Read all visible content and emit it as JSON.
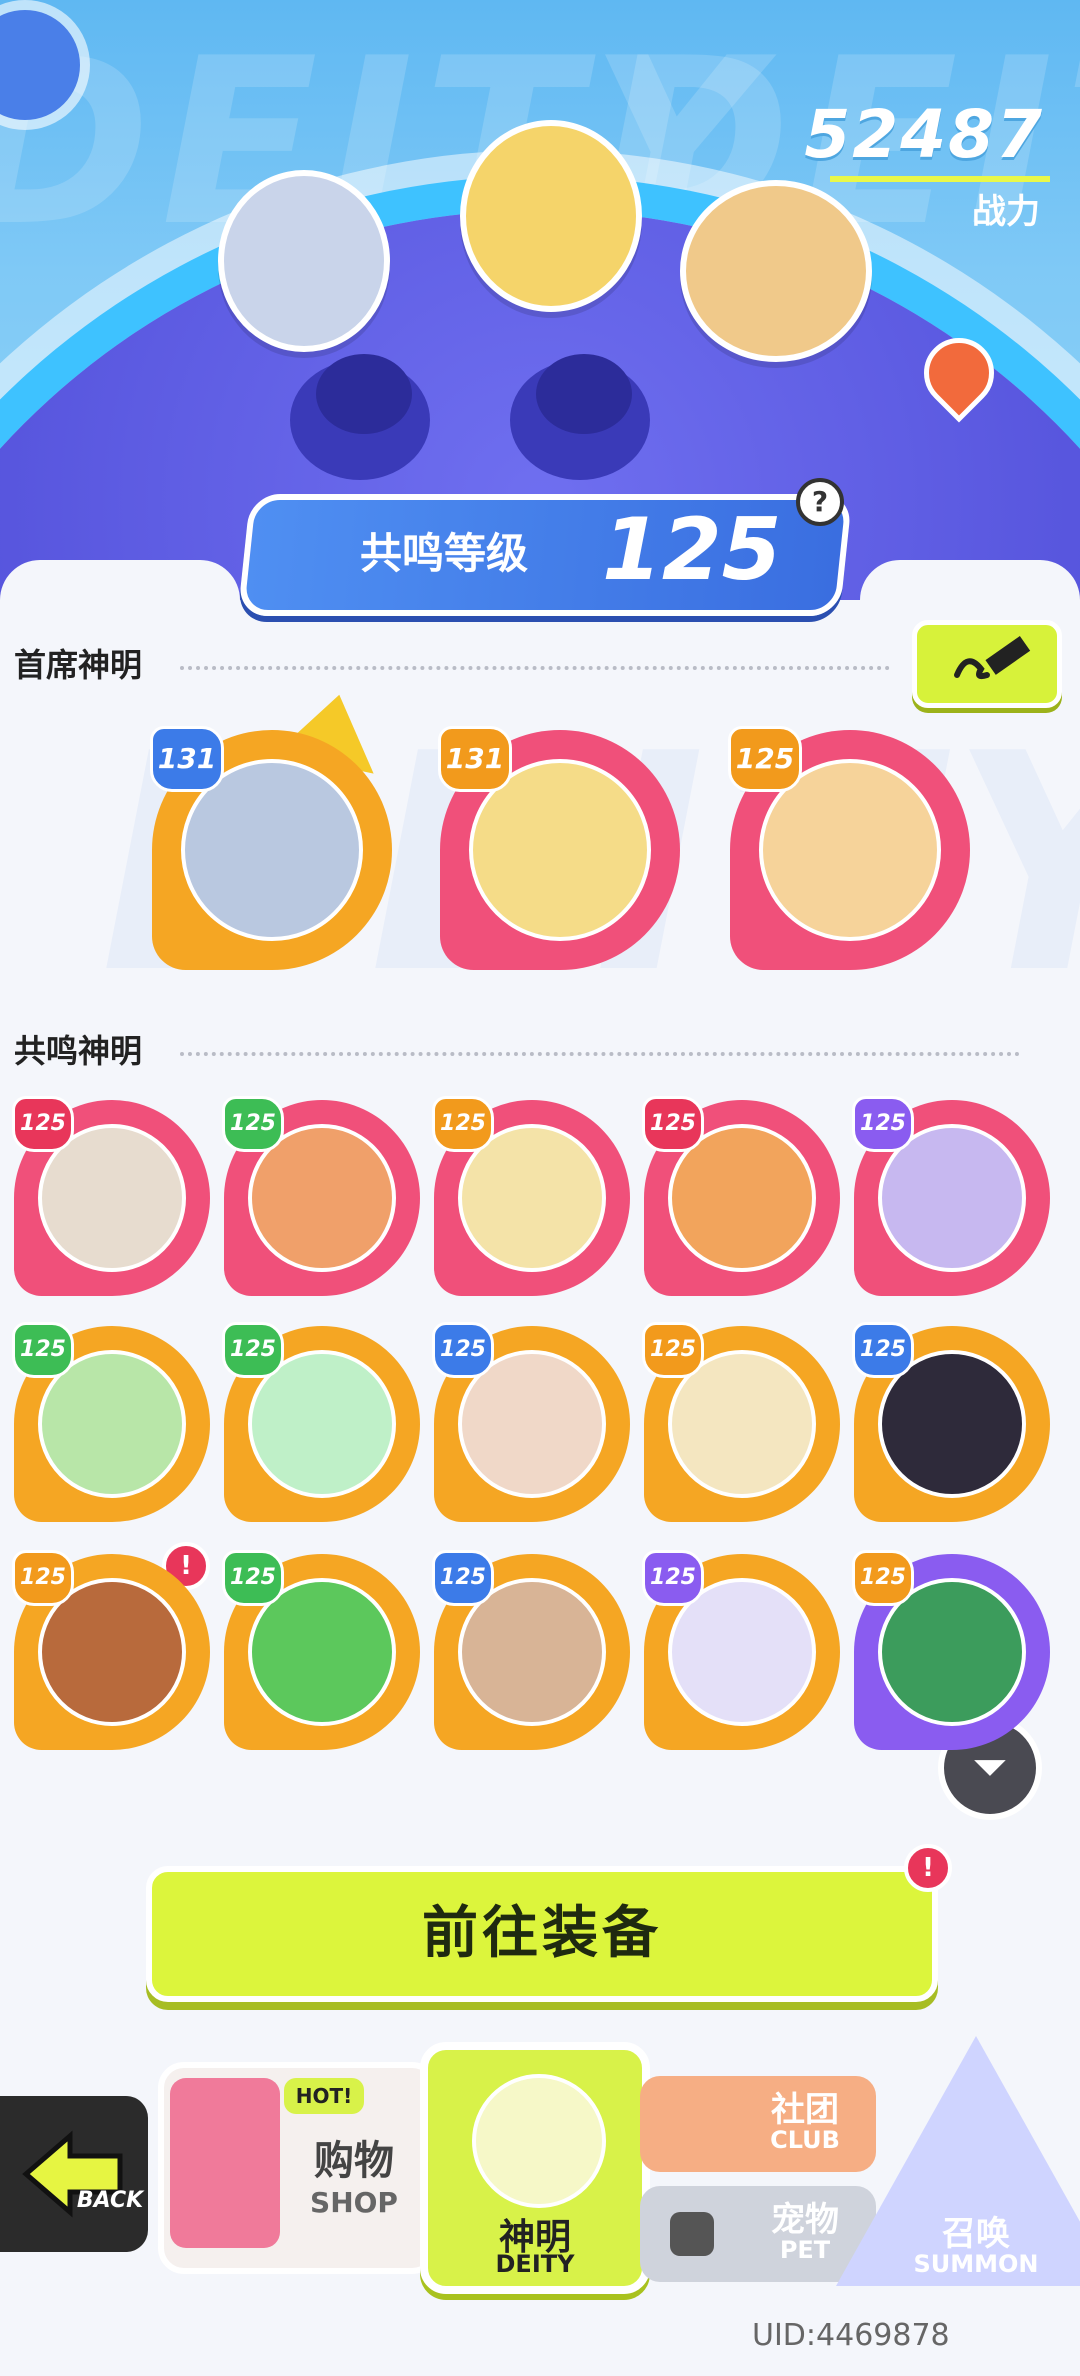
{
  "header": {
    "watermark": "DEITY",
    "power_value": "52487",
    "power_label": "战力",
    "resonance_label": "共鸣等级",
    "resonance_level": "125",
    "help_icon": "?"
  },
  "sections": {
    "primary_title": "首席神明",
    "resonance_title": "共鸣神明"
  },
  "primary_deities": [
    {
      "level": "131",
      "ring": "orange",
      "badge": "blue",
      "face": "#b9c8e0"
    },
    {
      "level": "131",
      "ring": "pink",
      "badge": "orange",
      "face": "#f5dc88"
    },
    {
      "level": "125",
      "ring": "pink",
      "badge": "orange",
      "face": "#f6d39a"
    }
  ],
  "resonance_deities": [
    {
      "level": "125",
      "ring": "pink",
      "badge": "red",
      "face": "#e7dccf"
    },
    {
      "level": "125",
      "ring": "pink",
      "badge": "green",
      "face": "#f0a06a"
    },
    {
      "level": "125",
      "ring": "pink",
      "badge": "orange",
      "face": "#f4e3a8"
    },
    {
      "level": "125",
      "ring": "pink",
      "badge": "red",
      "face": "#f2a45c"
    },
    {
      "level": "125",
      "ring": "pink",
      "badge": "purple",
      "face": "#c7b8f0"
    },
    {
      "level": "125",
      "ring": "orange",
      "badge": "green",
      "face": "#b8e6a8"
    },
    {
      "level": "125",
      "ring": "orange",
      "badge": "green",
      "face": "#bff0c8"
    },
    {
      "level": "125",
      "ring": "orange",
      "badge": "blue",
      "face": "#f0d8c8"
    },
    {
      "level": "125",
      "ring": "orange",
      "badge": "orange",
      "face": "#f4e6c0"
    },
    {
      "level": "125",
      "ring": "orange",
      "badge": "blue",
      "face": "#2e2a3a"
    },
    {
      "level": "125",
      "ring": "orange",
      "badge": "orange",
      "face": "#b86a3c"
    },
    {
      "level": "125",
      "ring": "orange",
      "badge": "green",
      "face": "#5cc85c"
    },
    {
      "level": "125",
      "ring": "orange",
      "badge": "blue",
      "face": "#d8b496"
    },
    {
      "level": "125",
      "ring": "orange",
      "badge": "purple",
      "face": "#e4e0f8"
    },
    {
      "level": "125",
      "ring": "purple",
      "badge": "orange",
      "face": "#3c9c5c"
    }
  ],
  "equip_button": "前往装备",
  "alert_mark": "!",
  "nav": {
    "back": "BACK",
    "shop_cn": "购物",
    "shop_en": "SHOP",
    "hot": "HOT!",
    "deity_cn": "神明",
    "deity_en": "DEITY",
    "club_cn": "社团",
    "club_en": "CLUB",
    "pet_cn": "宠物",
    "pet_en": "PET",
    "summon_cn": "召唤",
    "summon_en": "SUMMON"
  },
  "uid": "UID:4469878"
}
